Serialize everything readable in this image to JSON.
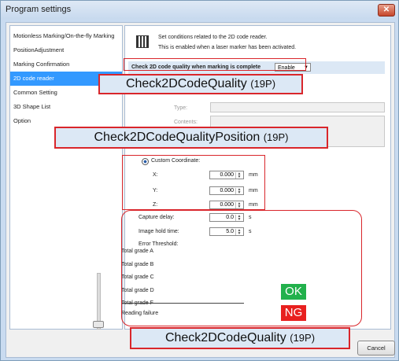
{
  "window": {
    "title": "Program settings",
    "close_glyph": "✕"
  },
  "sidebar": {
    "items": [
      {
        "label": "Motionless Marking/On-the-fly Marking"
      },
      {
        "label": "PositionAdjustment"
      },
      {
        "label": "Marking Confirmation"
      },
      {
        "label": "2D code reader",
        "selected": true
      },
      {
        "label": "Common Setting"
      },
      {
        "label": "3D Shape List"
      },
      {
        "label": "Option"
      }
    ]
  },
  "content": {
    "info_icon": "qr-code-icon",
    "info_line1": "Set conditions related to the 2D code reader.",
    "info_line2": "This is enabled when a laser marker has been activated.",
    "quality_label": "Check 2D code quality when marking is complete",
    "quality_select": "Enable",
    "type_label": "Type:",
    "contents_label": "Contents:",
    "custom_coordinate_label": "Custom Coordinate:",
    "coords": [
      {
        "label": "X:",
        "value": "0.000",
        "unit": "mm"
      },
      {
        "label": "Y:",
        "value": "0.000",
        "unit": "mm"
      },
      {
        "label": "Z:",
        "value": "0.000",
        "unit": "mm"
      }
    ],
    "capture_delay_label": "Capture delay:",
    "capture_delay_value": "0.0",
    "capture_delay_unit": "s",
    "image_hold_label": "Image hold time:",
    "image_hold_value": "5.0",
    "image_hold_unit": "s",
    "error_threshold_label": "Error Threshold:",
    "grades": [
      "Total grade A",
      "Total grade B",
      "Total grade C",
      "Total grade D",
      "Total grade F",
      "Reading failure"
    ]
  },
  "annotations": {
    "banner1_main": "Check2DCodeQuality",
    "banner1_page": "(19P)",
    "banner2_main": "Check2DCodeQualityPosition",
    "banner2_page": "(19P)",
    "banner3_main": "Check2DCodeQuality",
    "banner3_page": "(19P)",
    "ok_label": "OK",
    "ng_label": "NG",
    "accent_color": "#d9262b"
  },
  "footer": {
    "cancel_label": "Cancel"
  }
}
